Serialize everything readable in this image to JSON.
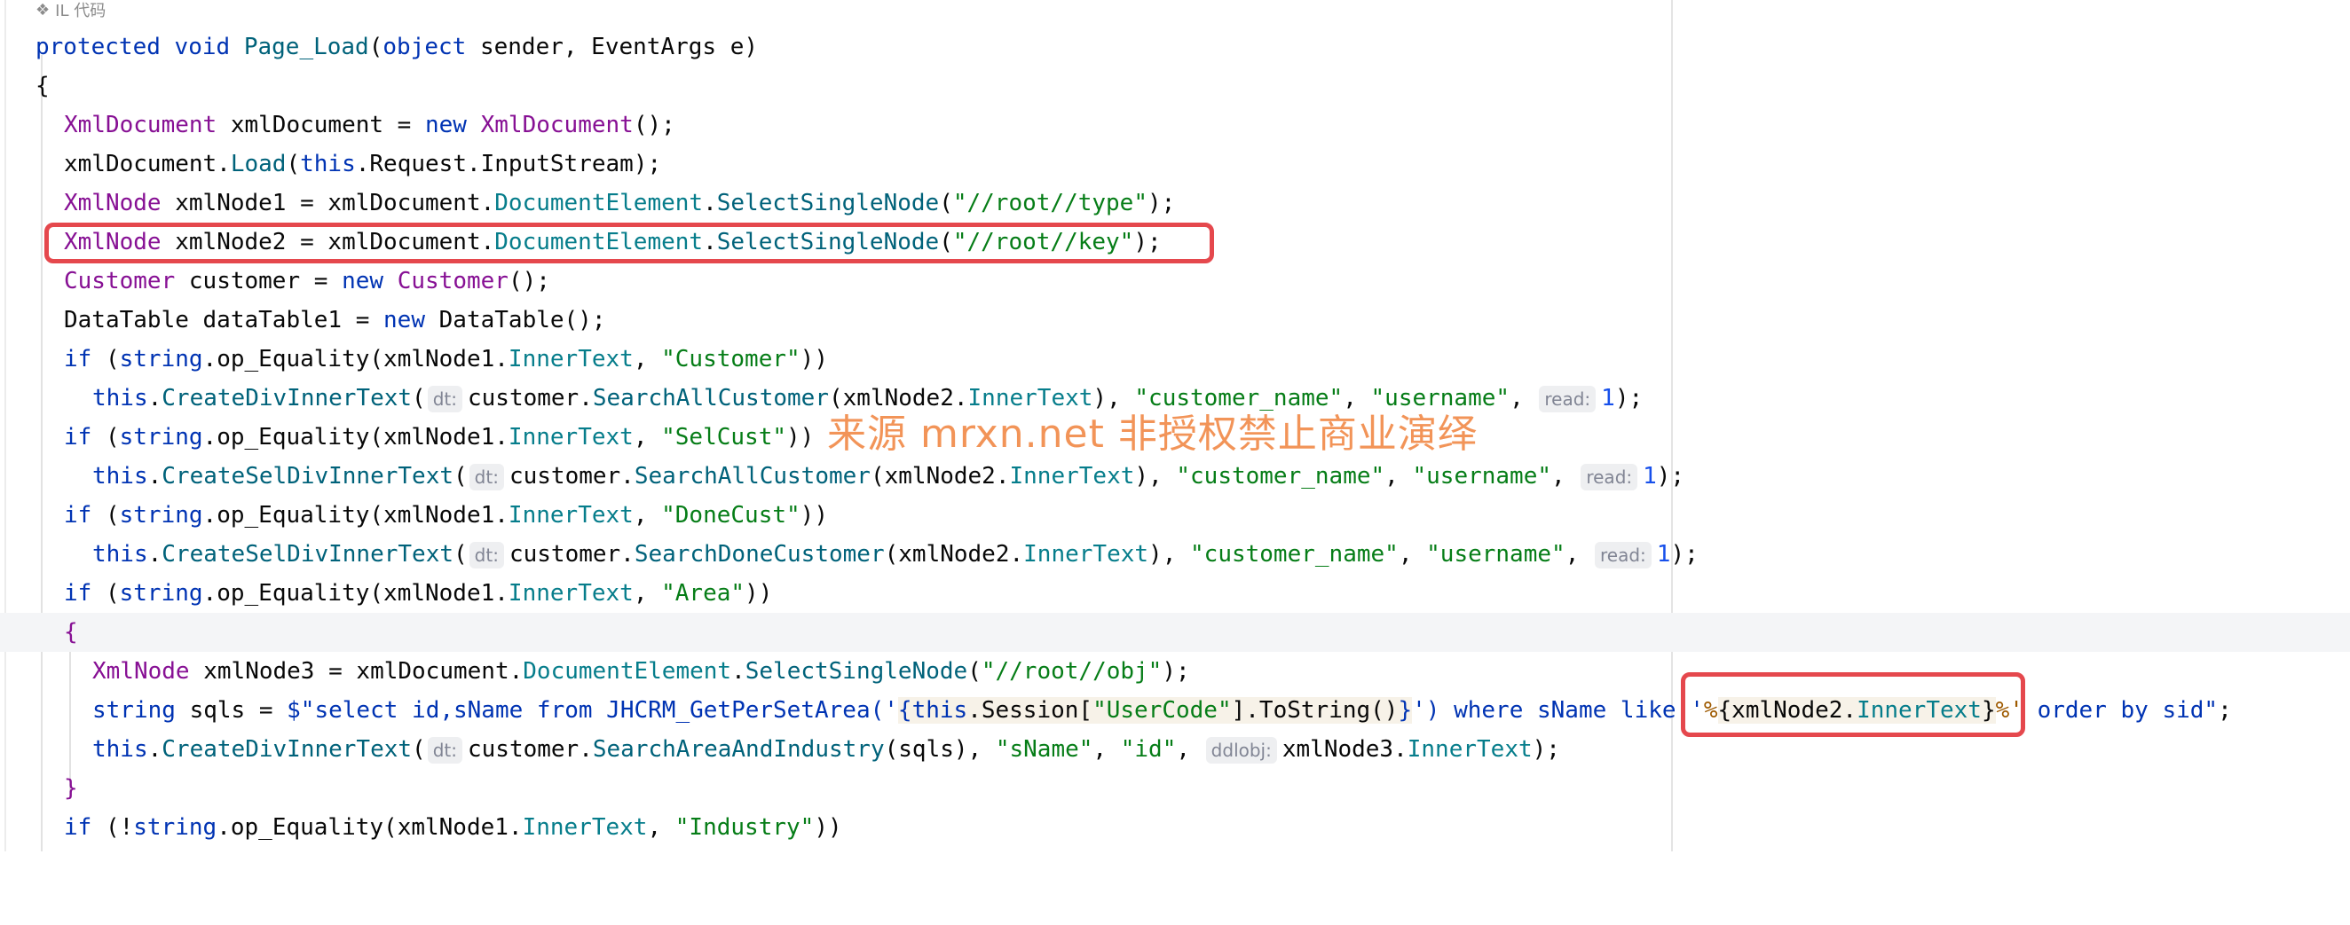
{
  "header": {
    "icon": "il-icon",
    "label": "IL 代码"
  },
  "watermark": "来源 mrxn.net 非授权禁止商业演绎",
  "colors": {
    "keyword": "#0033b3",
    "type": "#871094",
    "method": "#00627a",
    "string": "#067d17",
    "number": "#1750eb",
    "highlight_box": "#e5484d",
    "watermark": "#f0823c"
  },
  "code": {
    "l1": {
      "a": "protected",
      "b": "void",
      "c": "Page_Load",
      "d": "(",
      "e": "object",
      "f": " sender, EventArgs e)"
    },
    "l2": "{",
    "l3": {
      "a": "XmlDocument",
      "b": " xmlDocument = ",
      "c": "new",
      "d": "XmlDocument",
      "e": "();"
    },
    "l4": {
      "a": "xmlDocument.",
      "b": "Load",
      "c": "(",
      "d": "this",
      "e": ".Request.InputStream);"
    },
    "l5": {
      "a": "XmlNode",
      "b": " xmlNode1 = xmlDocument.",
      "c": "DocumentElement",
      "d": ".",
      "e": "SelectSingleNode",
      "f": "(",
      "g": "\"//root//type\"",
      "h": ");"
    },
    "l6": {
      "a": "XmlNode",
      "b": " xmlNode2 = xmlDocument.",
      "c": "DocumentElement",
      "d": ".",
      "e": "SelectSingleNode",
      "f": "(",
      "g": "\"//root//key\"",
      "h": ");"
    },
    "l7": {
      "a": "Customer",
      "b": " customer = ",
      "c": "new",
      "d": "Customer",
      "e": "();"
    },
    "l8": {
      "a": "DataTable dataTable1 = ",
      "b": "new",
      "c": " DataTable();"
    },
    "l9": {
      "a": "if",
      "b": " (",
      "c": "string",
      "d": ".op_Equality(xmlNode1.",
      "e": "InnerText",
      "f": ", ",
      "g": "\"Customer\"",
      "h": "))"
    },
    "l10": {
      "a": "this",
      "b": ".",
      "c": "CreateDivInnerText",
      "d": "(",
      "hint1": "dt:",
      "e": "customer.",
      "f": "SearchAllCustomer",
      "g": "(xmlNode2.",
      "h": "InnerText",
      "i": "), ",
      "j": "\"customer_name\"",
      "k": ", ",
      "l": "\"username\"",
      "m": ", ",
      "hint2": "read:",
      "n": "1",
      "o": ");"
    },
    "l11": {
      "a": "if",
      "b": " (",
      "c": "string",
      "d": ".op_Equality(xmlNode1.",
      "e": "InnerText",
      "f": ", ",
      "g": "\"SelCust\"",
      "h": "))"
    },
    "l12": {
      "a": "this",
      "b": ".",
      "c": "CreateSelDivInnerText",
      "d": "(",
      "hint1": "dt:",
      "e": "customer.",
      "f": "SearchAllCustomer",
      "g": "(xmlNode2.",
      "h": "InnerText",
      "i": "), ",
      "j": "\"customer_name\"",
      "k": ", ",
      "l": "\"username\"",
      "m": ", ",
      "hint2": "read:",
      "n": "1",
      "o": ");"
    },
    "l13": {
      "a": "if",
      "b": " (",
      "c": "string",
      "d": ".op_Equality(xmlNode1.",
      "e": "InnerText",
      "f": ", ",
      "g": "\"DoneCust\"",
      "h": "))"
    },
    "l14": {
      "a": "this",
      "b": ".",
      "c": "CreateSelDivInnerText",
      "d": "(",
      "hint1": "dt:",
      "e": "customer.",
      "f": "SearchDoneCustomer",
      "g": "(xmlNode2.",
      "h": "InnerText",
      "i": "), ",
      "j": "\"customer_name\"",
      "k": ", ",
      "l": "\"username\"",
      "m": ", ",
      "hint2": "read:",
      "n": "1",
      "o": ");"
    },
    "l15": {
      "a": "if",
      "b": " (",
      "c": "string",
      "d": ".op_Equality(xmlNode1.",
      "e": "InnerText",
      "f": ", ",
      "g": "\"Area\"",
      "h": "))"
    },
    "l16": "{",
    "l17": {
      "a": "XmlNode",
      "b": " xmlNode3 = xmlDocument.",
      "c": "DocumentElement",
      "d": ".",
      "e": "SelectSingleNode",
      "f": "(",
      "g": "\"//root//obj\"",
      "h": ");"
    },
    "l18": {
      "a": "string",
      "b": " sqls = ",
      "c": "$\"select id,sName from JHCRM_GetPerSetArea('",
      "d": "{",
      "e": "this",
      "f": ".Session[",
      "g": "\"UserCode\"",
      "h": "].ToString()",
      "i": "}",
      "j": "') where sName like '",
      "k": "%",
      "l": "{",
      "m": "xmlNode2.",
      "n": "InnerText",
      "o": "}",
      "p": "%'",
      "q": " order by sid\"",
      "r": ";"
    },
    "l19": {
      "a": "this",
      "b": ".",
      "c": "CreateDivInnerText",
      "d": "(",
      "hint1": "dt:",
      "e": "customer.",
      "f": "SearchAreaAndIndustry",
      "g": "(sqls), ",
      "h": "\"sName\"",
      "i": ", ",
      "j": "\"id\"",
      "k": ", ",
      "hint2": "ddlobj:",
      "l": "xmlNode3.",
      "m": "InnerText",
      "n": ");"
    },
    "l20": "}",
    "l21": {
      "a": "if",
      "b": " (!",
      "c": "string",
      "d": ".op_Equality(xmlNode1.",
      "e": "InnerText",
      "f": ", ",
      "g": "\"Industry\"",
      "h": "))"
    }
  }
}
